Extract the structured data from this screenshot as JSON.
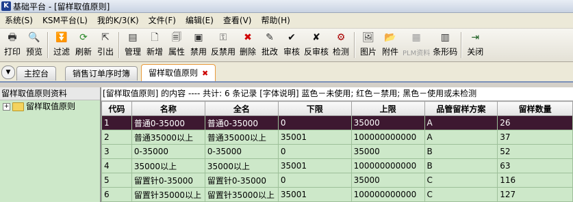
{
  "window": {
    "title": "基础平台 - [留样取值原则]"
  },
  "menu": [
    {
      "label": "系统(S)"
    },
    {
      "label": "KSM平台(L)"
    },
    {
      "label": "我的K/3(K)"
    },
    {
      "label": "文件(F)"
    },
    {
      "label": "编辑(E)"
    },
    {
      "label": "查看(V)"
    },
    {
      "label": "帮助(H)"
    }
  ],
  "toolbar": [
    {
      "label": "打印",
      "icon": "printer-icon",
      "glyph": "🖶",
      "color": "#333"
    },
    {
      "label": "预览",
      "icon": "preview-icon",
      "glyph": "🔍",
      "color": "#333"
    },
    {
      "sep": true
    },
    {
      "label": "过滤",
      "icon": "filter-icon",
      "glyph": "⏬",
      "color": "#2a6"
    },
    {
      "label": "刷新",
      "icon": "refresh-icon",
      "glyph": "⟳",
      "color": "#2a8a2a"
    },
    {
      "label": "引出",
      "icon": "export-icon",
      "glyph": "⇱",
      "color": "#333"
    },
    {
      "sep": true
    },
    {
      "label": "管理",
      "icon": "manage-icon",
      "glyph": "▤",
      "color": "#333"
    },
    {
      "label": "新增",
      "icon": "new-icon",
      "glyph": "🗋",
      "color": "#333"
    },
    {
      "label": "属性",
      "icon": "properties-icon",
      "glyph": "🗐",
      "color": "#333"
    },
    {
      "label": "禁用",
      "icon": "disable-icon",
      "glyph": "▣",
      "color": "#333"
    },
    {
      "label": "反禁用",
      "icon": "enable-icon",
      "glyph": "⚿",
      "color": "#555"
    },
    {
      "label": "删除",
      "icon": "delete-icon",
      "glyph": "✖",
      "color": "#d00000"
    },
    {
      "label": "批改",
      "icon": "batch-edit-icon",
      "glyph": "✎",
      "color": "#333"
    },
    {
      "label": "审核",
      "icon": "approve-icon",
      "glyph": "✔",
      "color": "#111"
    },
    {
      "label": "反审核",
      "icon": "unapprove-icon",
      "glyph": "✘",
      "color": "#111"
    },
    {
      "label": "检测",
      "icon": "check-icon",
      "glyph": "⚙",
      "color": "#a00"
    },
    {
      "sep": true
    },
    {
      "label": "图片",
      "icon": "picture-icon",
      "glyph": "🖼",
      "color": "#333"
    },
    {
      "label": "附件",
      "icon": "attachment-icon",
      "glyph": "📂",
      "color": "#b8860b"
    },
    {
      "label": "PLM资料",
      "icon": "plm-icon",
      "glyph": "▦",
      "color": "#9c9c9c",
      "disabled": true
    },
    {
      "label": "条形码",
      "icon": "barcode-icon",
      "glyph": "▥",
      "color": "#333"
    },
    {
      "sep": true
    },
    {
      "label": "关闭",
      "icon": "close-icon",
      "glyph": "⇥",
      "color": "#1b5e20"
    }
  ],
  "tabs": [
    {
      "label": "主控台",
      "active": false
    },
    {
      "label": "销售订单序时簿",
      "active": false
    },
    {
      "label": "留样取值原则",
      "active": true
    }
  ],
  "left_pane": {
    "title": "留样取值原则资料",
    "tree": [
      {
        "label": "留样取值原则",
        "expander": "+"
      }
    ]
  },
  "info_line": "[留样取值原则] 的内容 ---- 共计: 6 条记录 [字体说明] 蓝色－未使用; 红色－禁用; 黑色－使用或未检测",
  "grid": {
    "columns": [
      "代码",
      "名称",
      "全名",
      "下限",
      "上限",
      "品管留样方案",
      "留样数量"
    ],
    "rows": [
      [
        "1",
        "普通0-35000",
        "普通0-35000",
        "0",
        "35000",
        "A",
        "26"
      ],
      [
        "2",
        "普通35000以上",
        "普通35000以上",
        "35001",
        "100000000000",
        "A",
        "37"
      ],
      [
        "3",
        "0-35000",
        "0-35000",
        "0",
        "35000",
        "B",
        "52"
      ],
      [
        "4",
        "35000以上",
        "35000以上",
        "35001",
        "100000000000",
        "B",
        "63"
      ],
      [
        "5",
        "留置针0-35000",
        "留置针0-35000",
        "0",
        "35000",
        "C",
        "116"
      ],
      [
        "6",
        "留置针35000以上",
        "留置针35000以上",
        "35001",
        "100000000000",
        "C",
        "127"
      ]
    ],
    "selected_row": 0
  }
}
